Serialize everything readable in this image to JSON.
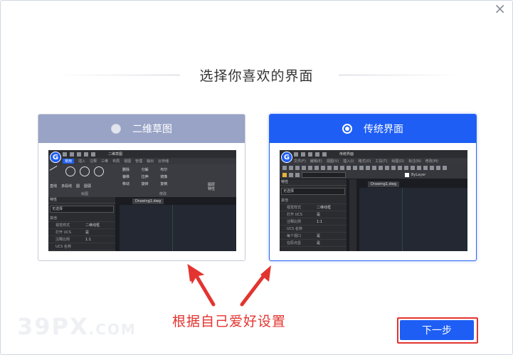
{
  "dialog": {
    "heading": "选择你喜欢的界面",
    "close_glyph": "×",
    "next_label": "下一步",
    "annotation": "根据自己爱好设置",
    "watermark_main": "39PX",
    "watermark_sub": ".COM"
  },
  "options": [
    {
      "label": "二维草图",
      "selected": false,
      "preview": {
        "logo": "G",
        "title": "二维草图",
        "tabs": [
          "常用",
          "插入",
          "注释",
          "三维",
          "布局",
          "视图",
          "管理",
          "输出",
          "云存储"
        ],
        "draw_tools": [
          "直线",
          "多段线",
          "圆",
          "圆弧"
        ],
        "modify_tools": [
          "删除",
          "分解",
          "布尔",
          "偏移",
          "拉伸",
          "镜像",
          "移动",
          "旋转",
          "复制"
        ],
        "right_tools": [
          "图层",
          "特性"
        ],
        "group_draw": "绘图",
        "group_modify": "修改",
        "panel_title": "特性",
        "selector": "无选择",
        "section": "其他",
        "props": [
          {
            "k": "视觉样式",
            "v": "二维线框"
          },
          {
            "k": "打开 UCS",
            "v": "是"
          },
          {
            "k": "注释比例",
            "v": "1:1"
          },
          {
            "k": "UCS 名称",
            "v": ""
          }
        ],
        "doc_tab": "Drawing1.dwg"
      }
    },
    {
      "label": "传统界面",
      "selected": true,
      "preview": {
        "logo": "G",
        "title": "传统界面",
        "menus": [
          "文件(F)",
          "编辑(E)",
          "视图(V)",
          "插入(I)",
          "格式(O)",
          "工具(T)",
          "绘图(D)",
          "标注(N)",
          "修改(M)"
        ],
        "layer": "ByLayer",
        "panel_title": "特性",
        "selector": "无选择",
        "section": "其他",
        "props": [
          {
            "k": "视觉样式",
            "v": "二维线框"
          },
          {
            "k": "打开 UCS",
            "v": "是"
          },
          {
            "k": "注释比例",
            "v": "1:1"
          },
          {
            "k": "UCS 名称",
            "v": ""
          },
          {
            "k": "每个视口",
            "v": "是"
          },
          {
            "k": "在原点显",
            "v": "是"
          }
        ],
        "doc_tab": "Drawing1.dwg"
      }
    }
  ],
  "colors": {
    "accent": "#1e5ef5",
    "unselected_header": "#98a3c6",
    "annotation_red": "#e3342f"
  }
}
